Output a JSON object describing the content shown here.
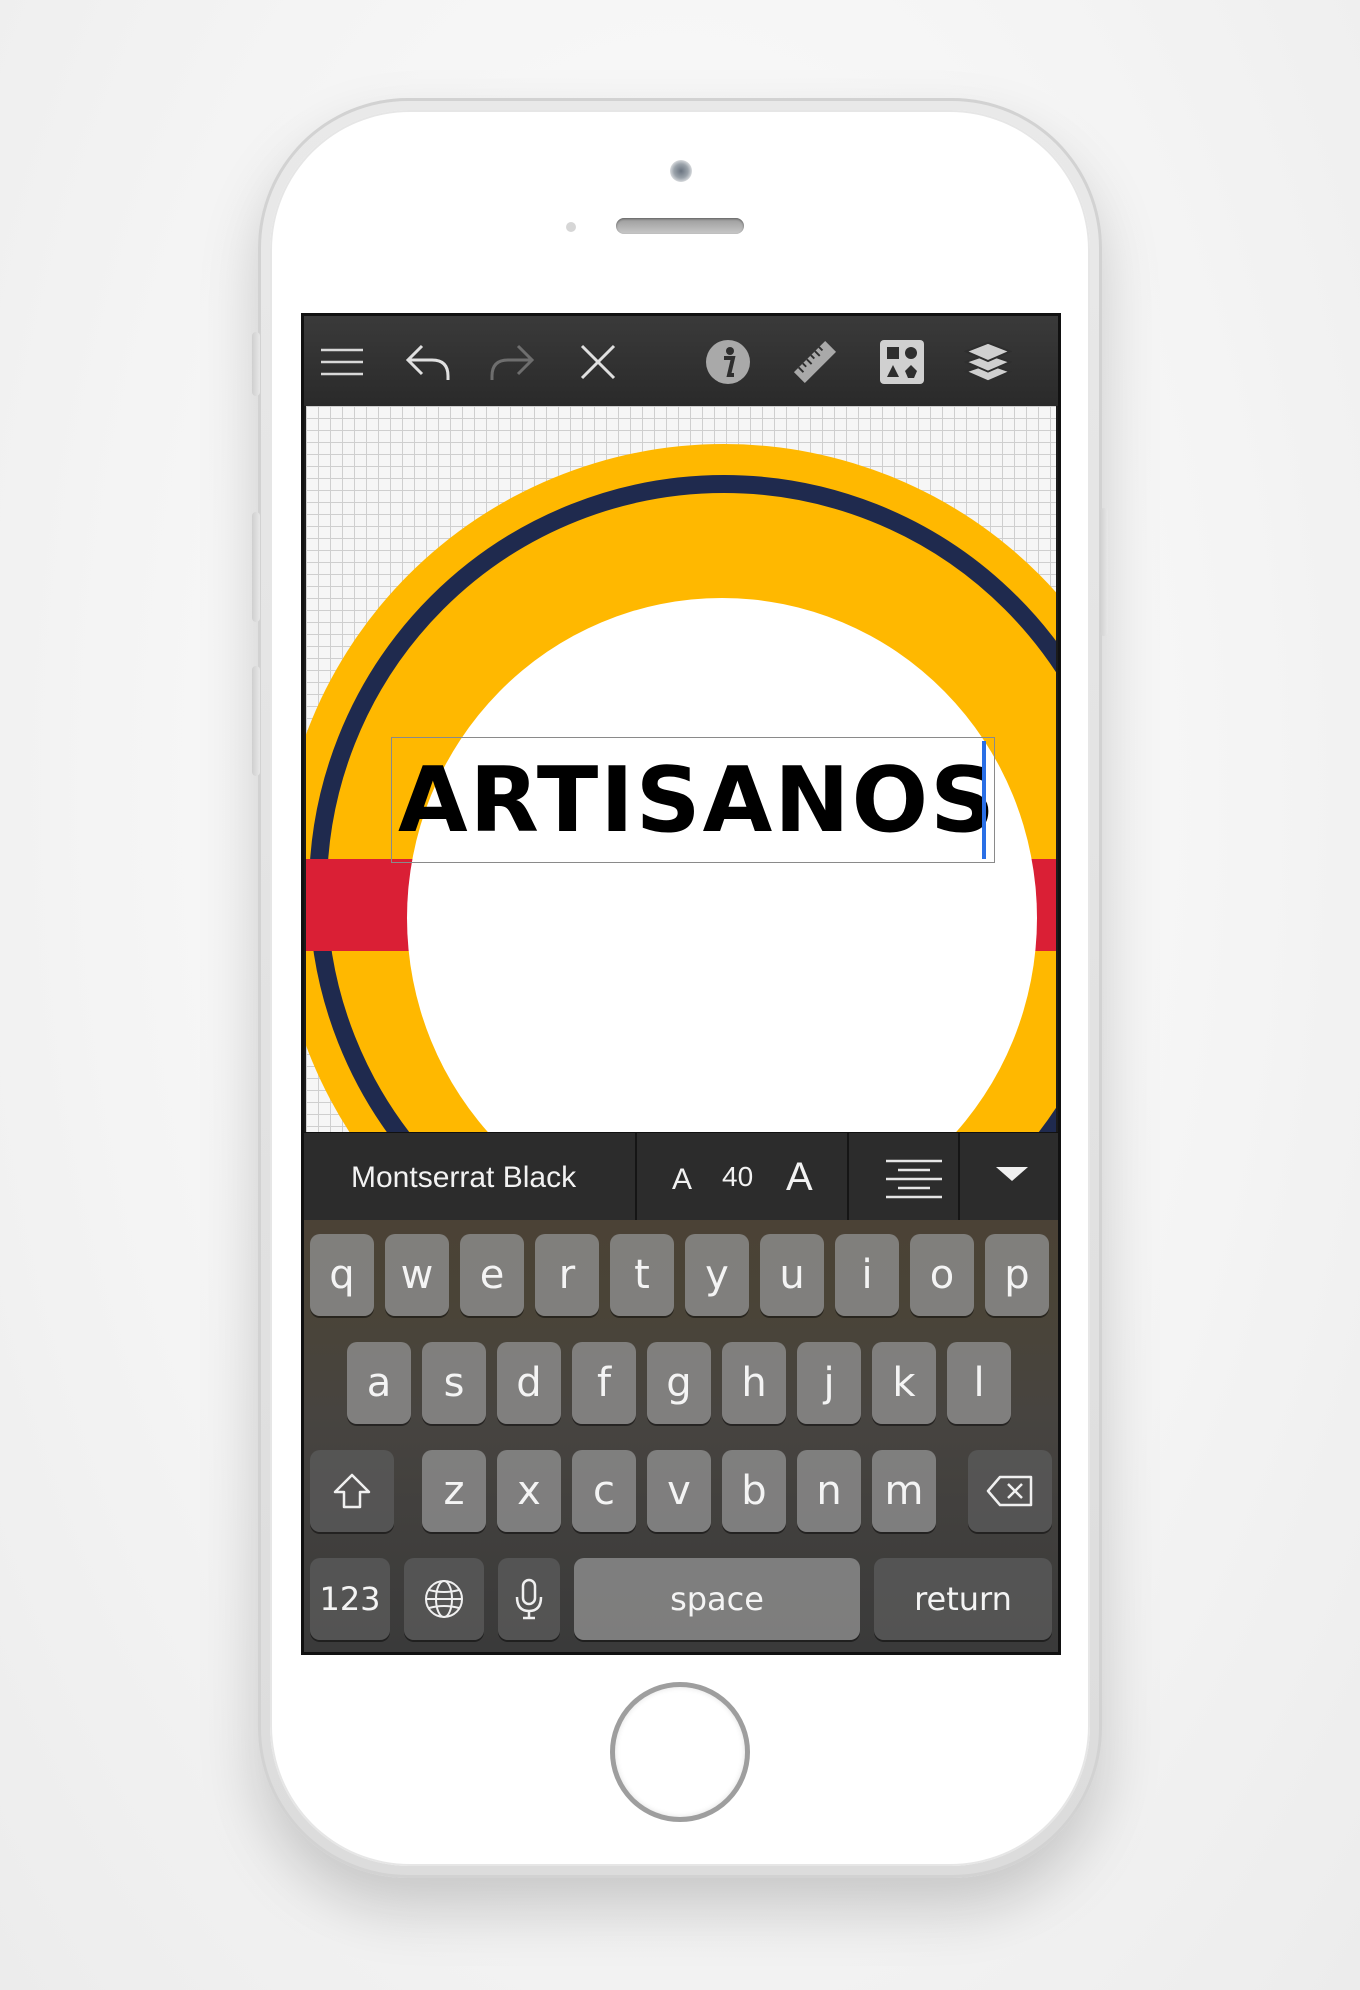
{
  "toolbar": {
    "icons": [
      "menu-icon",
      "undo-icon",
      "redo-icon",
      "close-icon",
      "info-icon",
      "ruler-icon",
      "shapes-icon",
      "layers-icon"
    ]
  },
  "canvas": {
    "text": "ARTISANOS",
    "colors": {
      "yellow": "#FFB800",
      "navy": "#1F2A4E",
      "red": "#DA1F35",
      "white": "#FFFFFF"
    }
  },
  "fontbar": {
    "font_name": "Montserrat Black",
    "size_small_label": "A",
    "size_value": "40",
    "size_large_label": "A",
    "align_icon": "align-center-icon",
    "dropdown_icon": "chevron-down-icon"
  },
  "keyboard": {
    "row1": [
      "q",
      "w",
      "e",
      "r",
      "t",
      "y",
      "u",
      "i",
      "o",
      "p"
    ],
    "row2": [
      "a",
      "s",
      "d",
      "f",
      "g",
      "h",
      "j",
      "k",
      "l"
    ],
    "row3": [
      "z",
      "x",
      "c",
      "v",
      "b",
      "n",
      "m"
    ],
    "numbers_label": "123",
    "space_label": "space",
    "return_label": "return"
  }
}
